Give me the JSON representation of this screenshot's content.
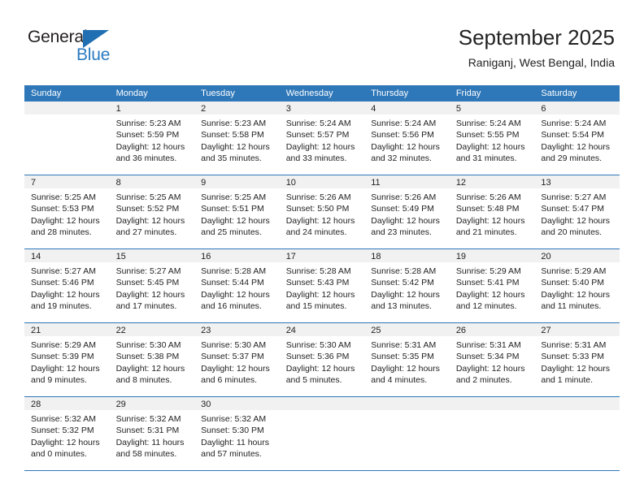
{
  "brand": {
    "name_top": "General",
    "name_bottom": "Blue",
    "accent_color": "#2a7ac0",
    "triangle_color": "#1f6fb2"
  },
  "header": {
    "title": "September 2025",
    "subtitle": "Raniganj, West Bengal, India"
  },
  "calendar": {
    "header_background": "#2e77b8",
    "daynum_background": "#f1f1f1",
    "weekday_headers": [
      "Sunday",
      "Monday",
      "Tuesday",
      "Wednesday",
      "Thursday",
      "Friday",
      "Saturday"
    ],
    "weeks": [
      [
        {
          "day": "",
          "lines": []
        },
        {
          "day": "1",
          "lines": [
            "Sunrise: 5:23 AM",
            "Sunset: 5:59 PM",
            "Daylight: 12 hours",
            "and 36 minutes."
          ]
        },
        {
          "day": "2",
          "lines": [
            "Sunrise: 5:23 AM",
            "Sunset: 5:58 PM",
            "Daylight: 12 hours",
            "and 35 minutes."
          ]
        },
        {
          "day": "3",
          "lines": [
            "Sunrise: 5:24 AM",
            "Sunset: 5:57 PM",
            "Daylight: 12 hours",
            "and 33 minutes."
          ]
        },
        {
          "day": "4",
          "lines": [
            "Sunrise: 5:24 AM",
            "Sunset: 5:56 PM",
            "Daylight: 12 hours",
            "and 32 minutes."
          ]
        },
        {
          "day": "5",
          "lines": [
            "Sunrise: 5:24 AM",
            "Sunset: 5:55 PM",
            "Daylight: 12 hours",
            "and 31 minutes."
          ]
        },
        {
          "day": "6",
          "lines": [
            "Sunrise: 5:24 AM",
            "Sunset: 5:54 PM",
            "Daylight: 12 hours",
            "and 29 minutes."
          ]
        }
      ],
      [
        {
          "day": "7",
          "lines": [
            "Sunrise: 5:25 AM",
            "Sunset: 5:53 PM",
            "Daylight: 12 hours",
            "and 28 minutes."
          ]
        },
        {
          "day": "8",
          "lines": [
            "Sunrise: 5:25 AM",
            "Sunset: 5:52 PM",
            "Daylight: 12 hours",
            "and 27 minutes."
          ]
        },
        {
          "day": "9",
          "lines": [
            "Sunrise: 5:25 AM",
            "Sunset: 5:51 PM",
            "Daylight: 12 hours",
            "and 25 minutes."
          ]
        },
        {
          "day": "10",
          "lines": [
            "Sunrise: 5:26 AM",
            "Sunset: 5:50 PM",
            "Daylight: 12 hours",
            "and 24 minutes."
          ]
        },
        {
          "day": "11",
          "lines": [
            "Sunrise: 5:26 AM",
            "Sunset: 5:49 PM",
            "Daylight: 12 hours",
            "and 23 minutes."
          ]
        },
        {
          "day": "12",
          "lines": [
            "Sunrise: 5:26 AM",
            "Sunset: 5:48 PM",
            "Daylight: 12 hours",
            "and 21 minutes."
          ]
        },
        {
          "day": "13",
          "lines": [
            "Sunrise: 5:27 AM",
            "Sunset: 5:47 PM",
            "Daylight: 12 hours",
            "and 20 minutes."
          ]
        }
      ],
      [
        {
          "day": "14",
          "lines": [
            "Sunrise: 5:27 AM",
            "Sunset: 5:46 PM",
            "Daylight: 12 hours",
            "and 19 minutes."
          ]
        },
        {
          "day": "15",
          "lines": [
            "Sunrise: 5:27 AM",
            "Sunset: 5:45 PM",
            "Daylight: 12 hours",
            "and 17 minutes."
          ]
        },
        {
          "day": "16",
          "lines": [
            "Sunrise: 5:28 AM",
            "Sunset: 5:44 PM",
            "Daylight: 12 hours",
            "and 16 minutes."
          ]
        },
        {
          "day": "17",
          "lines": [
            "Sunrise: 5:28 AM",
            "Sunset: 5:43 PM",
            "Daylight: 12 hours",
            "and 15 minutes."
          ]
        },
        {
          "day": "18",
          "lines": [
            "Sunrise: 5:28 AM",
            "Sunset: 5:42 PM",
            "Daylight: 12 hours",
            "and 13 minutes."
          ]
        },
        {
          "day": "19",
          "lines": [
            "Sunrise: 5:29 AM",
            "Sunset: 5:41 PM",
            "Daylight: 12 hours",
            "and 12 minutes."
          ]
        },
        {
          "day": "20",
          "lines": [
            "Sunrise: 5:29 AM",
            "Sunset: 5:40 PM",
            "Daylight: 12 hours",
            "and 11 minutes."
          ]
        }
      ],
      [
        {
          "day": "21",
          "lines": [
            "Sunrise: 5:29 AM",
            "Sunset: 5:39 PM",
            "Daylight: 12 hours",
            "and 9 minutes."
          ]
        },
        {
          "day": "22",
          "lines": [
            "Sunrise: 5:30 AM",
            "Sunset: 5:38 PM",
            "Daylight: 12 hours",
            "and 8 minutes."
          ]
        },
        {
          "day": "23",
          "lines": [
            "Sunrise: 5:30 AM",
            "Sunset: 5:37 PM",
            "Daylight: 12 hours",
            "and 6 minutes."
          ]
        },
        {
          "day": "24",
          "lines": [
            "Sunrise: 5:30 AM",
            "Sunset: 5:36 PM",
            "Daylight: 12 hours",
            "and 5 minutes."
          ]
        },
        {
          "day": "25",
          "lines": [
            "Sunrise: 5:31 AM",
            "Sunset: 5:35 PM",
            "Daylight: 12 hours",
            "and 4 minutes."
          ]
        },
        {
          "day": "26",
          "lines": [
            "Sunrise: 5:31 AM",
            "Sunset: 5:34 PM",
            "Daylight: 12 hours",
            "and 2 minutes."
          ]
        },
        {
          "day": "27",
          "lines": [
            "Sunrise: 5:31 AM",
            "Sunset: 5:33 PM",
            "Daylight: 12 hours",
            "and 1 minute."
          ]
        }
      ],
      [
        {
          "day": "28",
          "lines": [
            "Sunrise: 5:32 AM",
            "Sunset: 5:32 PM",
            "Daylight: 12 hours",
            "and 0 minutes."
          ]
        },
        {
          "day": "29",
          "lines": [
            "Sunrise: 5:32 AM",
            "Sunset: 5:31 PM",
            "Daylight: 11 hours",
            "and 58 minutes."
          ]
        },
        {
          "day": "30",
          "lines": [
            "Sunrise: 5:32 AM",
            "Sunset: 5:30 PM",
            "Daylight: 11 hours",
            "and 57 minutes."
          ]
        },
        {
          "day": "",
          "lines": []
        },
        {
          "day": "",
          "lines": []
        },
        {
          "day": "",
          "lines": []
        },
        {
          "day": "",
          "lines": []
        }
      ]
    ]
  }
}
